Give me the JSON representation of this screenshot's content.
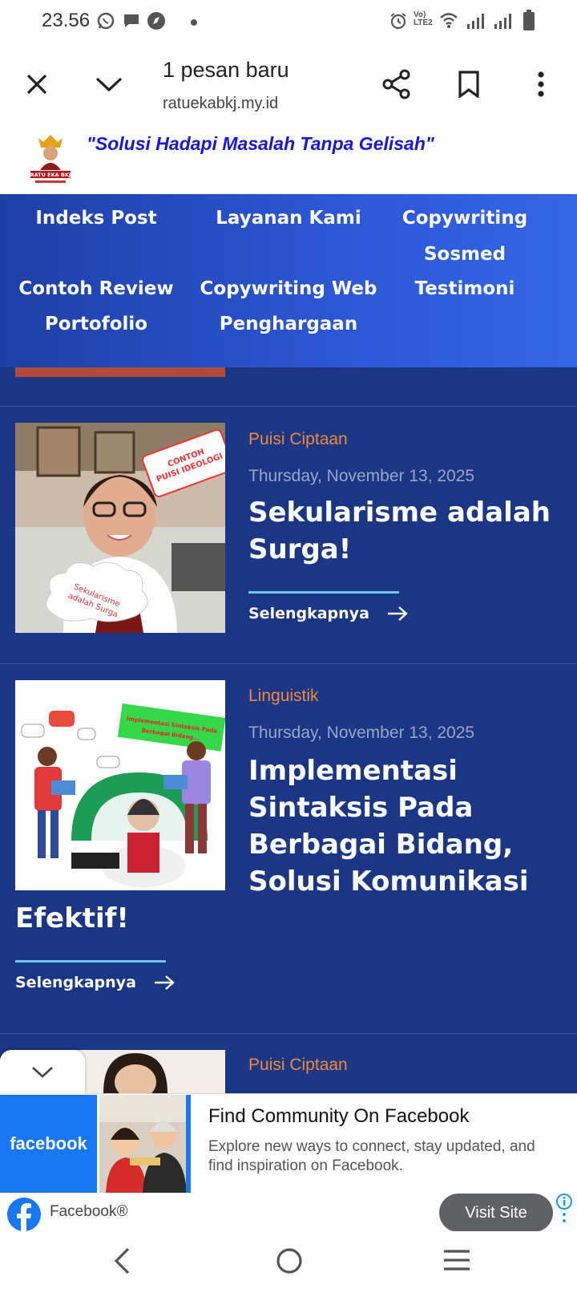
{
  "status_bar": {
    "time": "23.56",
    "lte_label": "LTE2"
  },
  "browser": {
    "title": "1 pesan baru",
    "url": "ratuekabkj.my.id"
  },
  "site": {
    "tagline": "\"Solusi Hadapi Masalah Tanpa Gelisah\"",
    "logo_text": "RATU EKA BKJ"
  },
  "nav": {
    "items": [
      "Indeks Post",
      "Layanan Kami",
      "Copywriting Sosmed",
      "Contoh Review",
      "Copywriting Web",
      "Testimoni",
      "Portofolio",
      "Penghargaan"
    ]
  },
  "posts": [
    {
      "category": "Puisi Ciptaan",
      "date": "Thursday, November 13, 2025",
      "title": "Sekularisme adalah Surga!",
      "more": "Selengkapnya",
      "sign_text": "CONTOH PUISI IDEOLOGI",
      "cloud_text": "Sekularisme adalah Surga"
    },
    {
      "category": "Linguistik",
      "date": "Thursday, November 13, 2025",
      "title_line1": "Implementasi",
      "title_line2": "Sintaksis Pada",
      "title_line3": "Berbagai Bidang,",
      "title_line4": "Solusi Komunikasi",
      "title_line5": "Efektif!",
      "more": "Selengkapnya",
      "banner_text": "Implementasi Sintaksis Pada Berbagai Bidang, Solusi Komunikasi Efektif!"
    },
    {
      "category": "Puisi Ciptaan"
    }
  ],
  "ad": {
    "brand": "facebook",
    "headline": "Find Community On Facebook",
    "body": "Explore new ways to connect, stay updated, and find inspiration on Facebook.",
    "advertiser": "Facebook®",
    "cta": "Visit Site"
  },
  "colors": {
    "nav_start": "#1e3fa6",
    "nav_end": "#3466e6",
    "main_bg": "#1a3685",
    "category": "#f08a3a",
    "accent_line": "#6cc6f4",
    "tagline": "#1717d4",
    "facebook_blue": "#1877f2"
  }
}
